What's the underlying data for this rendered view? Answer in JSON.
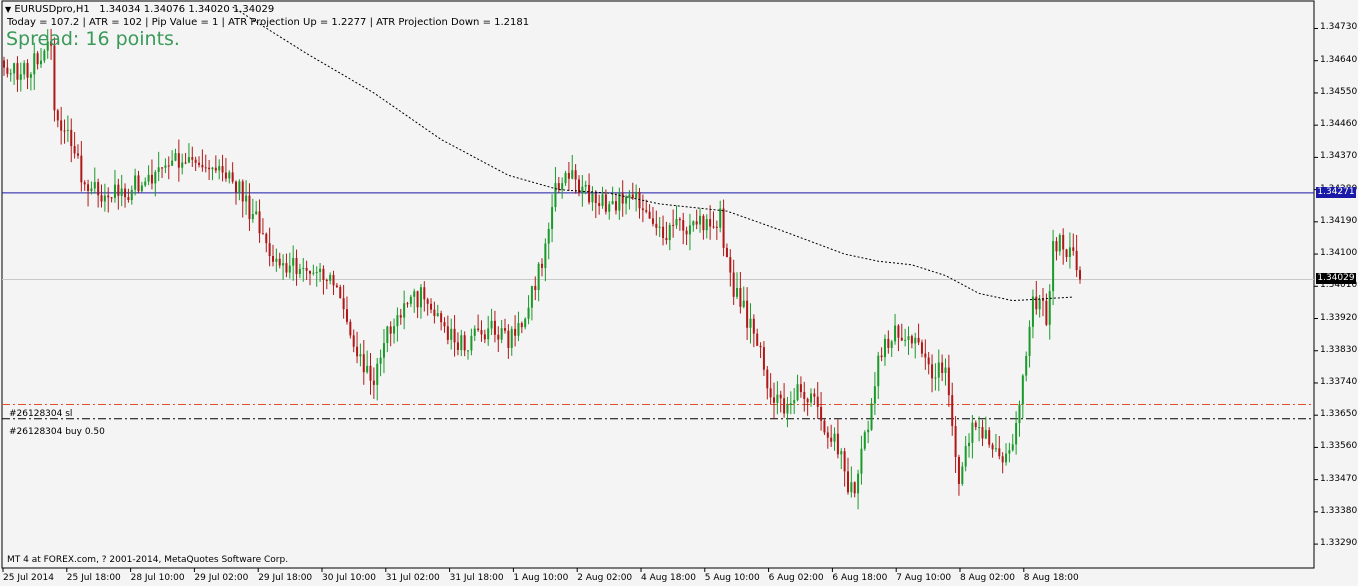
{
  "header": {
    "symbol": "EURUSDpro,H1",
    "ohlc": "1.34034 1.34076 1.34020 1.34029",
    "indicator_line": "Today = 107.2   |   ATR = 102   |   Pip Value = 1   |   ATR Projection Up = 1.2277   |   ATR Projection Down = 1.2181",
    "spread_text": "Spread: 16 points."
  },
  "orders": {
    "sl_label": "#26128304 sl",
    "buy_label": "#26128304 buy 0.50"
  },
  "footer": {
    "copyright": "MT 4 at FOREX.com, ? 2001-2014, MetaQuotes Software Corp."
  },
  "price_boxes": {
    "horizontal_line_price": "1.34271",
    "current_price": "1.34029"
  },
  "colors": {
    "background": "#f4f4f4",
    "bull_candle": "#1a9a2a",
    "bear_candle": "#b01818",
    "horizontal_line": "#1a1aa8",
    "sl_line": "#e0502a",
    "buy_line": "#000000",
    "spread_text": "#3a9a5a"
  },
  "chart_data": {
    "type": "candlestick",
    "symbol": "EURUSDpro",
    "timeframe": "H1",
    "ylim": [
      1.3324,
      1.3479
    ],
    "y_ticks": [
      "1.34730",
      "1.34640",
      "1.34550",
      "1.34460",
      "1.34370",
      "1.34280",
      "1.34190",
      "1.34100",
      "1.34010",
      "1.33920",
      "1.33830",
      "1.33740",
      "1.33650",
      "1.33560",
      "1.33470",
      "1.33380",
      "1.33290"
    ],
    "x_ticks": [
      "25 Jul 2014",
      "25 Jul 18:00",
      "28 Jul 10:00",
      "29 Jul 02:00",
      "29 Jul 18:00",
      "30 Jul 10:00",
      "31 Jul 02:00",
      "31 Jul 18:00",
      "1 Aug 10:00",
      "2 Aug 02:00",
      "4 Aug 18:00",
      "5 Aug 10:00",
      "6 Aug 02:00",
      "6 Aug 18:00",
      "7 Aug 10:00",
      "8 Aug 02:00",
      "8 Aug 18:00"
    ],
    "horizontal_line": 1.34271,
    "current_price": 1.34029,
    "order_sl_level": 1.3368,
    "order_buy_level": 1.3364,
    "close_anchors": [
      [
        0,
        1.3461
      ],
      [
        5,
        1.346
      ],
      [
        12,
        1.3466
      ],
      [
        14,
        1.347
      ],
      [
        15,
        1.345
      ],
      [
        20,
        1.344
      ],
      [
        25,
        1.3428
      ],
      [
        35,
        1.3427
      ],
      [
        45,
        1.3432
      ],
      [
        55,
        1.3438
      ],
      [
        65,
        1.3432
      ],
      [
        70,
        1.3428
      ],
      [
        75,
        1.3419
      ],
      [
        80,
        1.3408
      ],
      [
        85,
        1.3406
      ],
      [
        90,
        1.3406
      ],
      [
        95,
        1.3405
      ],
      [
        100,
        1.3398
      ],
      [
        105,
        1.3382
      ],
      [
        110,
        1.3375
      ],
      [
        113,
        1.3387
      ],
      [
        118,
        1.3395
      ],
      [
        125,
        1.3399
      ],
      [
        130,
        1.3392
      ],
      [
        135,
        1.3384
      ],
      [
        140,
        1.3387
      ],
      [
        145,
        1.3389
      ],
      [
        150,
        1.3386
      ],
      [
        155,
        1.3392
      ],
      [
        160,
        1.3408
      ],
      [
        164,
        1.3428
      ],
      [
        168,
        1.3432
      ],
      [
        172,
        1.3428
      ],
      [
        178,
        1.3424
      ],
      [
        185,
        1.3425
      ],
      [
        190,
        1.3424
      ],
      [
        195,
        1.3416
      ],
      [
        200,
        1.3418
      ],
      [
        205,
        1.3417
      ],
      [
        210,
        1.3419
      ],
      [
        213,
        1.342
      ],
      [
        216,
        1.3403
      ],
      [
        220,
        1.3394
      ],
      [
        224,
        1.3384
      ],
      [
        228,
        1.3372
      ],
      [
        232,
        1.3365
      ],
      [
        236,
        1.3372
      ],
      [
        240,
        1.337
      ],
      [
        244,
        1.3362
      ],
      [
        248,
        1.3357
      ],
      [
        251,
        1.3345
      ],
      [
        253,
        1.3343
      ],
      [
        256,
        1.3358
      ],
      [
        260,
        1.338
      ],
      [
        264,
        1.3388
      ],
      [
        268,
        1.3389
      ],
      [
        272,
        1.3385
      ],
      [
        276,
        1.3376
      ],
      [
        280,
        1.3381
      ],
      [
        282,
        1.3364
      ],
      [
        284,
        1.3346
      ],
      [
        288,
        1.3362
      ],
      [
        292,
        1.3361
      ],
      [
        296,
        1.3353
      ],
      [
        300,
        1.3358
      ],
      [
        303,
        1.3376
      ],
      [
        306,
        1.3398
      ],
      [
        310,
        1.3393
      ],
      [
        312,
        1.3412
      ],
      [
        314,
        1.3413
      ],
      [
        318,
        1.341
      ],
      [
        320,
        1.3403
      ]
    ],
    "moving_average_dotted": [
      [
        68,
        1.3479
      ],
      [
        90,
        1.3466
      ],
      [
        110,
        1.3455
      ],
      [
        130,
        1.3442
      ],
      [
        150,
        1.3432
      ],
      [
        165,
        1.3428
      ],
      [
        180,
        1.3427
      ],
      [
        195,
        1.3424
      ],
      [
        215,
        1.3422
      ],
      [
        230,
        1.3417
      ],
      [
        250,
        1.341
      ],
      [
        260,
        1.3408
      ],
      [
        270,
        1.3407
      ],
      [
        280,
        1.3404
      ],
      [
        290,
        1.3399
      ],
      [
        300,
        1.3397
      ],
      [
        318,
        1.3398
      ]
    ],
    "bar_count": 321
  }
}
